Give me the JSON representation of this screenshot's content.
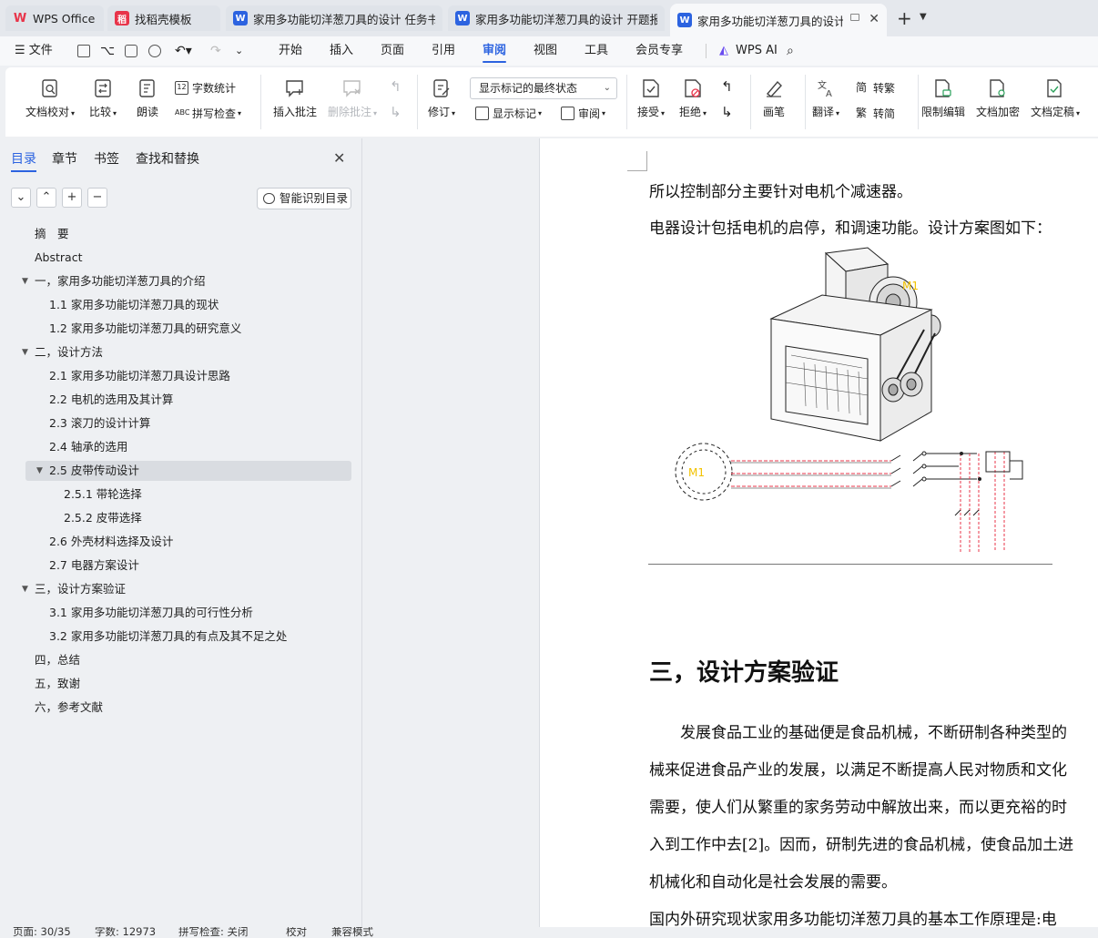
{
  "tabs": [
    {
      "label": "WPS Office",
      "icon": "wps-logo-icon"
    },
    {
      "label": "找稻壳模板",
      "icon": "docer-icon"
    },
    {
      "label": "家用多功能切洋葱刀具的设计 任务书",
      "icon": "word-doc-icon"
    },
    {
      "label": "家用多功能切洋葱刀具的设计 开题报告",
      "icon": "word-doc-icon"
    },
    {
      "label": "家用多功能切洋葱刀具的设计",
      "icon": "word-doc-icon"
    }
  ],
  "menu": {
    "file": "文件",
    "items": [
      "开始",
      "插入",
      "页面",
      "引用",
      "审阅",
      "视图",
      "工具",
      "会员专享"
    ],
    "active": "审阅",
    "wps_ai": "WPS AI"
  },
  "ribbon": {
    "proofread": "文档校对",
    "compare": "比较",
    "read_aloud": "朗读",
    "word_count": "字数统计",
    "spell_check": "拼写检查",
    "insert_comment": "插入批注",
    "delete_comment": "删除批注",
    "track_changes": "修订",
    "markup_state": "显示标记的最终状态",
    "show_markup": "显示标记",
    "review_pane": "审阅",
    "accept": "接受",
    "reject": "拒绝",
    "pen": "画笔",
    "translate": "翻译",
    "to_traditional": "转繁",
    "to_simplified": "转简",
    "restrict_edit": "限制编辑",
    "encrypt": "文档加密",
    "finalize": "文档定稿"
  },
  "sidebar": {
    "tabs": [
      "目录",
      "章节",
      "书签",
      "查找和替换"
    ],
    "active_tab": "目录",
    "smart_toc": "智能识别目录",
    "toc": [
      {
        "text": "摘　要",
        "level": 1,
        "arrow": false
      },
      {
        "text": "Abstract",
        "level": 1,
        "arrow": false
      },
      {
        "text": "一，家用多功能切洋葱刀具的介绍",
        "level": 1,
        "arrow": true
      },
      {
        "text": "1.1 家用多功能切洋葱刀具的现状",
        "level": 2,
        "arrow": false
      },
      {
        "text": "1.2 家用多功能切洋葱刀具的研究意义",
        "level": 2,
        "arrow": false
      },
      {
        "text": "二，设计方法",
        "level": 1,
        "arrow": true
      },
      {
        "text": "2.1 家用多功能切洋葱刀具设计思路",
        "level": 2,
        "arrow": false
      },
      {
        "text": "2.2 电机的选用及其计算",
        "level": 2,
        "arrow": false
      },
      {
        "text": "2.3 滚刀的设计计算",
        "level": 2,
        "arrow": false
      },
      {
        "text": "2.4 轴承的选用",
        "level": 2,
        "arrow": false
      },
      {
        "text": "2.5 皮带传动设计",
        "level": 2,
        "arrow": true,
        "selected": true
      },
      {
        "text": "2.5.1 带轮选择",
        "level": 3,
        "arrow": false
      },
      {
        "text": "2.5.2 皮带选择",
        "level": 3,
        "arrow": false
      },
      {
        "text": "2.6 外壳材料选择及设计",
        "level": 2,
        "arrow": false
      },
      {
        "text": "2.7 电器方案设计",
        "level": 2,
        "arrow": false
      },
      {
        "text": "三，设计方案验证",
        "level": 1,
        "arrow": true
      },
      {
        "text": "3.1 家用多功能切洋葱刀具的可行性分析",
        "level": 2,
        "arrow": false
      },
      {
        "text": "3.2 家用多功能切洋葱刀具的有点及其不足之处",
        "level": 2,
        "arrow": false
      },
      {
        "text": "四，总结",
        "level": 1,
        "arrow": false
      },
      {
        "text": "五，致谢",
        "level": 1,
        "arrow": false
      },
      {
        "text": "六，参考文献",
        "level": 1,
        "arrow": false
      }
    ]
  },
  "document": {
    "line1": "所以控制部分主要针对电机个减速器。",
    "line2": "电器设计包括电机的启停，和调速功能。设计方案图如下：",
    "figure_labels": {
      "motor_top": "M1",
      "motor_circuit": "M1"
    },
    "heading": "三，设计方案验证",
    "para": [
      "　　发展食品工业的基础便是食品机械，不断研制各种类型的",
      "械来促进食品产业的发展，以满足不断提高人民对物质和文化",
      "需要，使人们从繁重的家务劳动中解放出来，而以更充裕的时",
      "入到工作中去[2]。因而，研制先进的食品机械，使食品加土进",
      "机械化和自动化是社会发展的需要。",
      "国内外研究现状家用多功能切洋葱刀具的基本工作原理是:电"
    ]
  },
  "statusbar": {
    "page": "页面: 30/35",
    "words": "字数: 12973",
    "spell": "拼写检查: 关闭",
    "proof": "校对",
    "compat": "兼容模式"
  },
  "colors": {
    "accent": "#2c63e0",
    "wps_red": "#e8344a"
  }
}
